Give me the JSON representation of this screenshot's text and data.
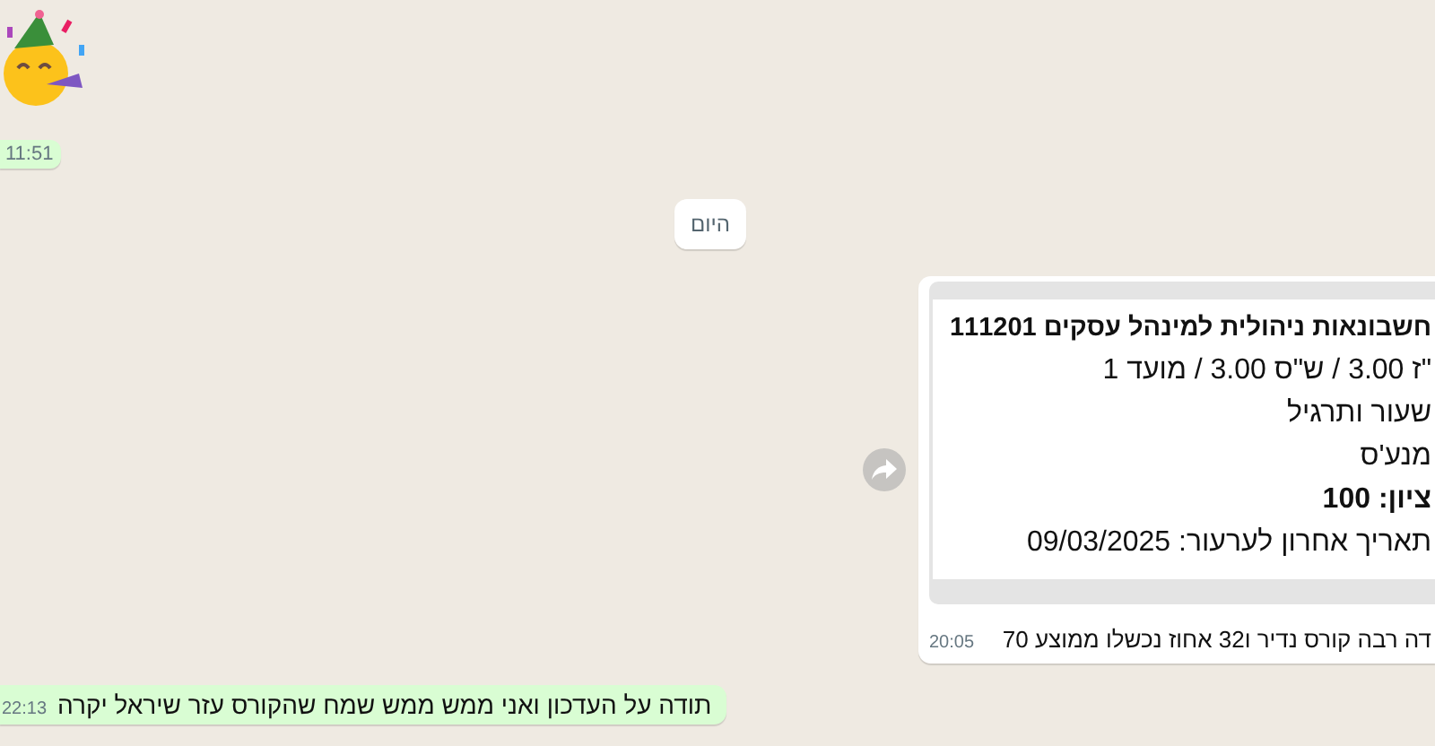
{
  "messages": [
    {
      "kind": "sticker",
      "time": "11:51"
    },
    {
      "kind": "date",
      "label": "היום"
    },
    {
      "kind": "card",
      "preview_lines": [
        {
          "text": "חשבונאות ניהולית למינהל עסקים 111201",
          "bold": true
        },
        {
          "text": "\"ז 3.00 / ש\"ס 3.00 / מועד 1",
          "bold": false
        },
        {
          "text": "שעור ותרגיל",
          "bold": false
        },
        {
          "text": "מנע'ס",
          "bold": false
        },
        {
          "text": "ציון: 100",
          "bold": true
        },
        {
          "text": "תאריך אחרון לערעור: 09/03/2025",
          "bold": false
        }
      ],
      "caption": "דה רבה קורס נדיר ו32 אחוז נכשלו ממוצע 70",
      "time": "20:05"
    },
    {
      "kind": "outgoing",
      "text": "תודה על העדכון ואני ממש ממש שמח שהקורס עזר שיראל יקרה",
      "time": "22:13"
    }
  ]
}
